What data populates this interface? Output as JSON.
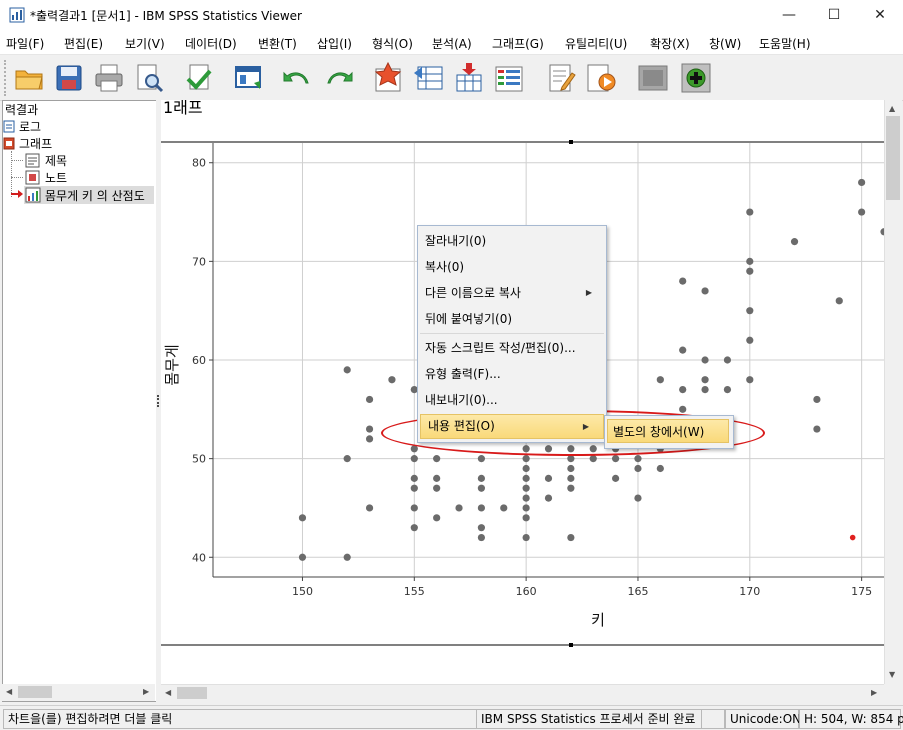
{
  "window": {
    "title": "*출력결과1 [문서1] - IBM SPSS Statistics Viewer",
    "minimize": "—",
    "maximize": "☐",
    "close": "✕"
  },
  "menu": [
    "파일(F)",
    "편집(E)",
    "보기(V)",
    "데이터(D)",
    "변환(T)",
    "삽입(I)",
    "형식(O)",
    "분석(A)",
    "그래프(G)",
    "유틸리티(U)",
    "확장(X)",
    "창(W)",
    "도움말(H)"
  ],
  "toolbar_icons": [
    "open-folder-icon",
    "save-icon",
    "print-icon",
    "print-preview-icon",
    "export-icon",
    "recall-dialog-icon",
    "undo-icon",
    "redo-icon",
    "goto-data-icon",
    "goto-case-icon",
    "variables-icon",
    "select-cases-icon",
    "designate-window-icon",
    "edit-script-icon",
    "run-script-icon",
    "placeholder-icon",
    "add-icon"
  ],
  "outline": {
    "root": "력결과",
    "log": "로그",
    "graph": "그래프",
    "title": "제목",
    "note": "노트",
    "chart": "몸무게 키 의 산점도"
  },
  "content": {
    "heading": "1래프"
  },
  "chart_data": {
    "type": "scatter",
    "title": "",
    "xlabel": "키",
    "ylabel": "몸무게",
    "xlim": [
      146,
      176
    ],
    "ylim": [
      38,
      82
    ],
    "xticks": [
      150,
      155,
      160,
      165,
      170,
      175
    ],
    "yticks": [
      40,
      50,
      60,
      70,
      80
    ],
    "grid": true,
    "point_color": "#6b6b6b",
    "points": [
      [
        150,
        40
      ],
      [
        150,
        44
      ],
      [
        152,
        59
      ],
      [
        152,
        50
      ],
      [
        152,
        40
      ],
      [
        153,
        56
      ],
      [
        153,
        53
      ],
      [
        153,
        52
      ],
      [
        153,
        45
      ],
      [
        154,
        58
      ],
      [
        155,
        57
      ],
      [
        155,
        51
      ],
      [
        155,
        50
      ],
      [
        155,
        48
      ],
      [
        155,
        47
      ],
      [
        155,
        45
      ],
      [
        155,
        43
      ],
      [
        156,
        53
      ],
      [
        156,
        50
      ],
      [
        156,
        48
      ],
      [
        156,
        47
      ],
      [
        156,
        44
      ],
      [
        157,
        57
      ],
      [
        157,
        55
      ],
      [
        157,
        54
      ],
      [
        157,
        45
      ],
      [
        158,
        52
      ],
      [
        158,
        50
      ],
      [
        158,
        48
      ],
      [
        158,
        47
      ],
      [
        158,
        45
      ],
      [
        158,
        43
      ],
      [
        158,
        42
      ],
      [
        159,
        45
      ],
      [
        160,
        52
      ],
      [
        160,
        51
      ],
      [
        160,
        50
      ],
      [
        160,
        49
      ],
      [
        160,
        48
      ],
      [
        160,
        47
      ],
      [
        160,
        46
      ],
      [
        160,
        45
      ],
      [
        160,
        44
      ],
      [
        160,
        42
      ],
      [
        161,
        51
      ],
      [
        161,
        48
      ],
      [
        161,
        46
      ],
      [
        162,
        52
      ],
      [
        162,
        51
      ],
      [
        162,
        50
      ],
      [
        162,
        49
      ],
      [
        162,
        48
      ],
      [
        162,
        47
      ],
      [
        162,
        42
      ],
      [
        163,
        50
      ],
      [
        163,
        51
      ],
      [
        164,
        51
      ],
      [
        164,
        50
      ],
      [
        164,
        48
      ],
      [
        165,
        50
      ],
      [
        165,
        49
      ],
      [
        165,
        46
      ],
      [
        166,
        58
      ],
      [
        166,
        52
      ],
      [
        166,
        51
      ],
      [
        166,
        49
      ],
      [
        167,
        68
      ],
      [
        167,
        61
      ],
      [
        167,
        57
      ],
      [
        167,
        55
      ],
      [
        168,
        67
      ],
      [
        168,
        60
      ],
      [
        168,
        58
      ],
      [
        168,
        57
      ],
      [
        169,
        60
      ],
      [
        169,
        57
      ],
      [
        170,
        75
      ],
      [
        170,
        70
      ],
      [
        170,
        69
      ],
      [
        170,
        65
      ],
      [
        170,
        62
      ],
      [
        170,
        58
      ],
      [
        172,
        72
      ],
      [
        173,
        56
      ],
      [
        173,
        53
      ],
      [
        174,
        66
      ],
      [
        175,
        78
      ],
      [
        175,
        75
      ],
      [
        176,
        73
      ]
    ],
    "highlight_point": [
      174.6,
      42
    ]
  },
  "context_menu": {
    "items": [
      "잘라내기(0)",
      "복사(0)",
      "다른 이름으로 복사",
      "뒤에 붙여넣기(0)",
      "자동 스크립트 작성/편집(0)...",
      "유형 출력(F)...",
      "내보내기(0)...",
      "내용 편집(O)"
    ],
    "submenu": "별도의 창에서(W)"
  },
  "status": {
    "hint": "차트을(를) 편집하려면 더블 클릭",
    "processor": "IBM SPSS Statistics 프로세서 준비 완료",
    "unicode": "Unicode:ON",
    "size": "H: 504, W: 854 pt."
  },
  "colors": {
    "highlight_ring": "#d81a1a",
    "menu_highlight": "#f9d97a",
    "selected_marker": "#e0201e"
  }
}
